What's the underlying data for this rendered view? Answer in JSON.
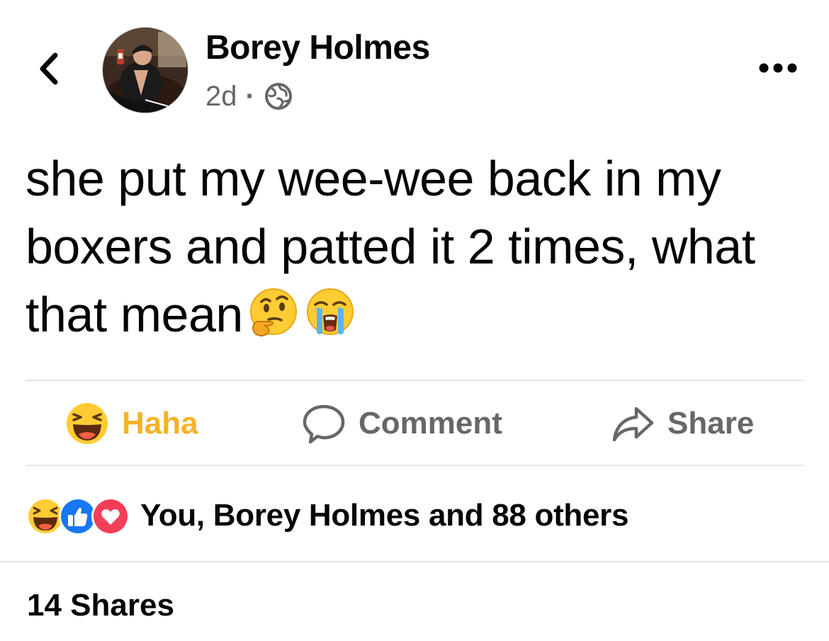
{
  "header": {
    "author_name": "Borey Holmes",
    "time": "2d",
    "separator": "·",
    "audience_icon": "globe-icon",
    "back_icon": "chevron-left-icon",
    "more_icon": "more-horizontal-icon"
  },
  "post": {
    "text": "she put my wee-wee back in my boxers and patted it 2 times, what that mean",
    "emojis": [
      "thinking-face-emoji",
      "loudly-crying-face-emoji"
    ]
  },
  "actions": {
    "haha_label": "Haha",
    "comment_label": "Comment",
    "share_label": "Share",
    "haha_color": "#f7b125",
    "inactive_color": "#65676b"
  },
  "reactions": {
    "icons": [
      "haha-icon",
      "like-icon",
      "love-icon"
    ],
    "summary": "You, Borey Holmes and 88 others"
  },
  "shares": {
    "text": "14 Shares"
  },
  "colors": {
    "like_blue": "#1877f2",
    "love_red": "#f33e58",
    "divider": "#e4e6eb",
    "secondary_text": "#65676b"
  }
}
